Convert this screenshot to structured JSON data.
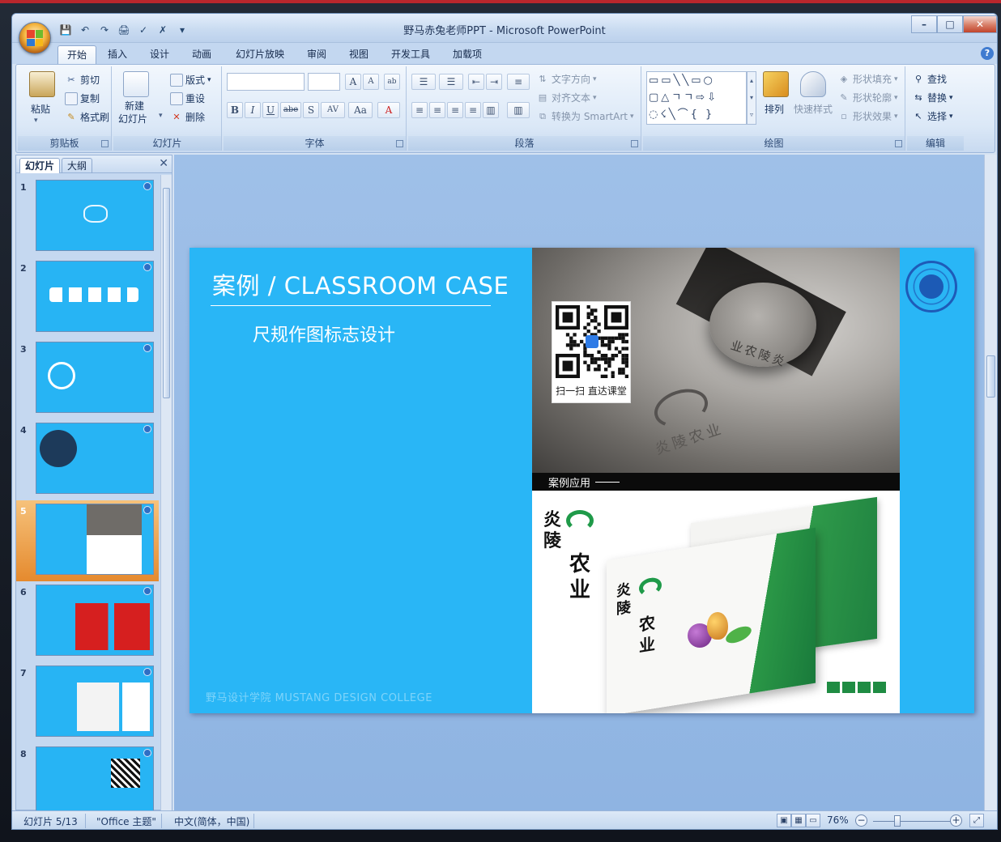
{
  "window": {
    "title": "野马赤兔老师PPT - Microsoft PowerPoint",
    "controls": [
      "–",
      "□",
      "✕"
    ]
  },
  "quick_access": [
    "💾",
    "↶",
    "↷",
    "🖨",
    "✓",
    "✗",
    "▾"
  ],
  "tabs": [
    {
      "label": "开始",
      "active": true
    },
    {
      "label": "插入"
    },
    {
      "label": "设计"
    },
    {
      "label": "动画"
    },
    {
      "label": "幻灯片放映"
    },
    {
      "label": "审阅"
    },
    {
      "label": "视图"
    },
    {
      "label": "开发工具"
    },
    {
      "label": "加载项"
    }
  ],
  "ribbon": {
    "clipboard": {
      "label": "剪贴板",
      "paste": "粘贴",
      "cut": "剪切",
      "copy": "复制",
      "format_painter": "格式刷"
    },
    "slides": {
      "label": "幻灯片",
      "new_slide": "新建\n幻灯片",
      "new_slide_line1": "新建",
      "new_slide_line2": "幻灯片",
      "layout": "版式",
      "reset": "重设",
      "delete": "删除"
    },
    "font": {
      "label": "字体",
      "bold": "B",
      "italic": "I",
      "underline": "U",
      "strike": "abe",
      "shadow": "S",
      "spacing": "AV",
      "case": "Aa",
      "color": "A",
      "grow": "A",
      "shrink": "A"
    },
    "paragraph": {
      "label": "段落",
      "text_direction": "文字方向",
      "align_text": "对齐文本",
      "smartart": "转换为 SmartArt"
    },
    "drawing": {
      "label": "绘图",
      "arrange": "排列",
      "quick_styles": "快速样式",
      "shape_fill": "形状填充",
      "shape_outline": "形状轮廓",
      "shape_effects": "形状效果"
    },
    "editing": {
      "label": "编辑",
      "find": "查找",
      "replace": "替换",
      "select": "选择"
    }
  },
  "pane": {
    "tab_slides": "幻灯片",
    "tab_outline": "大纲",
    "close": "✕",
    "selected": 5,
    "thumbnails": [
      1,
      2,
      3,
      4,
      5,
      6,
      7,
      8
    ]
  },
  "slide": {
    "title": "案例 / CLASSROOM CASE",
    "subtitle": "尺规作图标志设计",
    "footer": "野马设计学院   MUSTANG DESIGN COLLEGE",
    "qr_caption": "扫一扫 直达课堂",
    "case_label": "案例应用",
    "emboss_text": "炎陵农业",
    "emboss_text_top": "业农陵炎",
    "brand_chars": [
      "炎",
      "陵",
      "农",
      "业"
    ],
    "colors": {
      "background": "#29b6f6",
      "brand_green": "#1f9a49"
    }
  },
  "status": {
    "slide_info": "幻灯片 5/13",
    "theme": "\"Office 主题\"",
    "language": "中文(简体，中国)",
    "zoom": "76%",
    "zoom_level": 0.76
  }
}
